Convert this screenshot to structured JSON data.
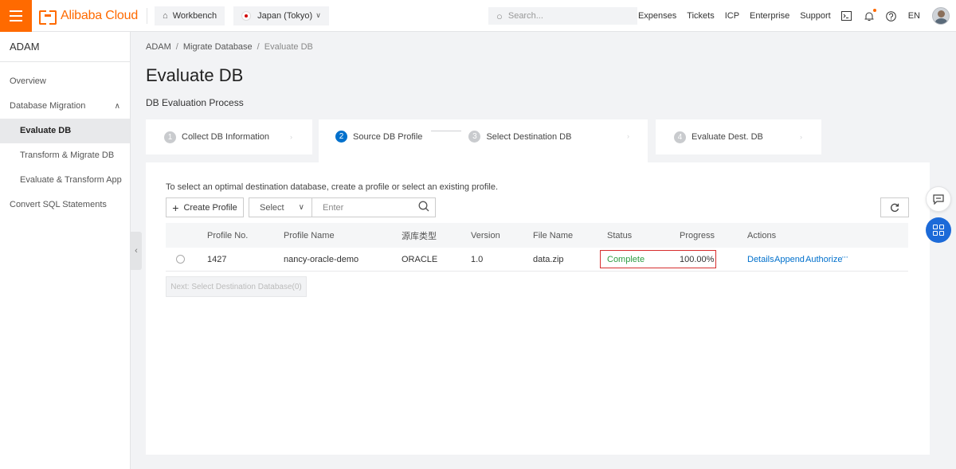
{
  "topbar": {
    "brand": "Alibaba Cloud",
    "workbench": "Workbench",
    "region": "Japan (Tokyo)",
    "search_placeholder": "Search...",
    "links": [
      "Expenses",
      "Tickets",
      "ICP",
      "Enterprise",
      "Support"
    ],
    "lang": "EN"
  },
  "sidebar": {
    "title": "ADAM",
    "items": [
      {
        "label": "Overview"
      },
      {
        "label": "Database Migration"
      },
      {
        "label": "Evaluate DB"
      },
      {
        "label": "Transform & Migrate DB"
      },
      {
        "label": "Evaluate & Transform App"
      },
      {
        "label": "Convert SQL Statements"
      }
    ]
  },
  "breadcrumb": {
    "items": [
      "ADAM",
      "Migrate Database",
      "Evaluate DB"
    ]
  },
  "page": {
    "title": "Evaluate DB",
    "subtitle": "DB Evaluation Process"
  },
  "steps": [
    {
      "num": "1",
      "label": "Collect DB Information"
    },
    {
      "num": "2",
      "label": "Source DB Profile"
    },
    {
      "num": "3",
      "label": "Select Destination DB"
    },
    {
      "num": "4",
      "label": "Evaluate Dest. DB"
    }
  ],
  "panel": {
    "hint": "To select an optimal destination database, create a profile or select an existing profile.",
    "create_label": "Create Profile",
    "select_label": "Select",
    "search_placeholder": "Enter",
    "next_label": "Next: Select Destination Database(0)"
  },
  "table": {
    "headers": [
      "Profile No.",
      "Profile Name",
      "源库类型",
      "Version",
      "File Name",
      "Status",
      "Progress",
      "Actions"
    ],
    "rows": [
      {
        "profile_no": "1427",
        "profile_name": "nancy-oracle-demo",
        "source_type": "ORACLE",
        "version": "1.0",
        "file_name": "data.zip",
        "status": "Complete",
        "progress": "100.00%",
        "actions": [
          "Details",
          "Append",
          "Authorize",
          "···"
        ]
      }
    ]
  },
  "colors": {
    "brand": "#ff6a00",
    "primary": "#0070cc",
    "success": "#2e9c42",
    "highlight": "#d62e2e"
  }
}
